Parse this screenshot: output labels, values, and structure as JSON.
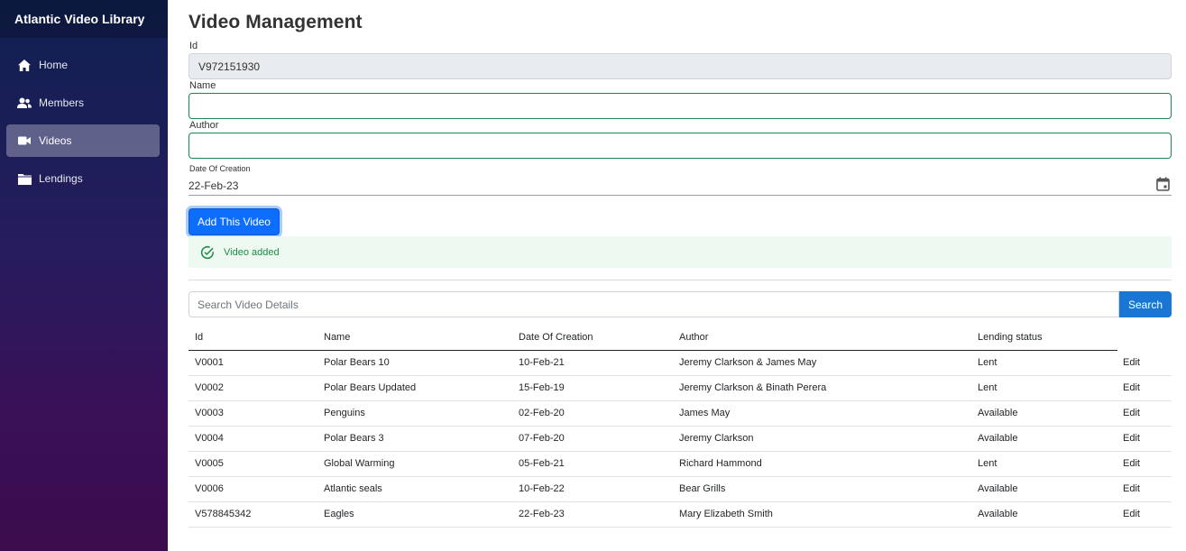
{
  "sidebar": {
    "brand": "Atlantic Video Library",
    "items": [
      {
        "label": "Home",
        "icon": "home-icon"
      },
      {
        "label": "Members",
        "icon": "members-icon"
      },
      {
        "label": "Videos",
        "icon": "video-camera-icon",
        "active": true
      },
      {
        "label": "Lendings",
        "icon": "folder-icon"
      }
    ]
  },
  "page": {
    "title": "Video Management"
  },
  "form": {
    "id_label": "Id",
    "id_value": "V972151930",
    "name_label": "Name",
    "name_value": "",
    "author_label": "Author",
    "author_value": "",
    "date_label": "Date Of Creation",
    "date_value": "22-Feb-23",
    "add_button": "Add This Video"
  },
  "alert": {
    "text": "Video added",
    "color": "#1e8c46"
  },
  "search": {
    "placeholder": "Search Video Details",
    "button": "Search"
  },
  "table": {
    "headers": [
      "Id",
      "Name",
      "Date Of Creation",
      "Author",
      "Lending status",
      ""
    ],
    "rows": [
      [
        "V0001",
        "Polar Bears 10",
        "10-Feb-21",
        "Jeremy Clarkson & James May",
        "Lent",
        "Edit"
      ],
      [
        "V0002",
        "Polar Bears Updated",
        "15-Feb-19",
        "Jeremy Clarkson & Binath Perera",
        "Lent",
        "Edit"
      ],
      [
        "V0003",
        "Penguins",
        "02-Feb-20",
        "James May",
        "Available",
        "Edit"
      ],
      [
        "V0004",
        "Polar Bears 3",
        "07-Feb-20",
        "Jeremy Clarkson",
        "Available",
        "Edit"
      ],
      [
        "V0005",
        "Global Warming",
        "05-Feb-21",
        "Richard Hammond",
        "Lent",
        "Edit"
      ],
      [
        "V0006",
        "Atlantic seals",
        "10-Feb-22",
        "Bear Grills",
        "Available",
        "Edit"
      ],
      [
        "V578845342",
        "Eagles",
        "22-Feb-23",
        "Mary Elizabeth Smith",
        "Available",
        "Edit"
      ]
    ]
  },
  "colors": {
    "primary": "#0d6efd",
    "search_button": "#1976d2",
    "valid_border": "#198754"
  }
}
